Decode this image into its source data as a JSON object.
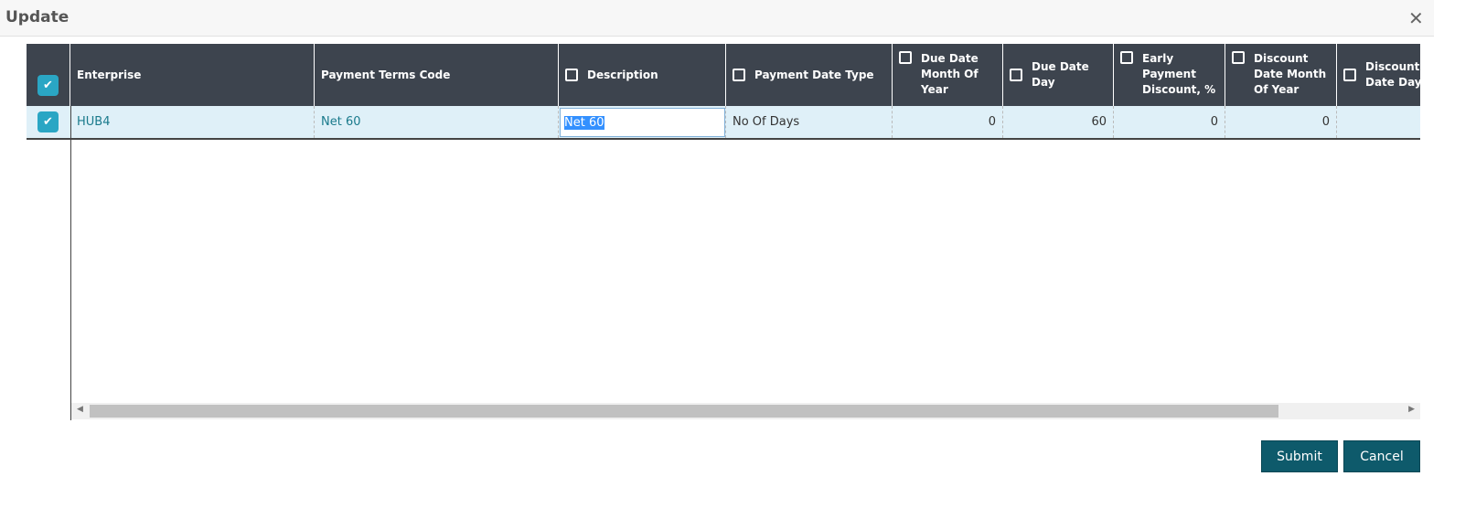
{
  "dialog": {
    "title": "Update"
  },
  "columns": [
    "Enterprise",
    "Payment Terms Code",
    "Description",
    "Payment Date Type",
    "Due Date Month Of Year",
    "Due Date Day",
    "Early Payment Discount, %",
    "Discount Date Month Of Year",
    "Discount Date Day"
  ],
  "row": {
    "enterprise": "HUB4",
    "payment_terms_code": "Net 60",
    "description": "Net 60",
    "payment_date_type": "No Of Days",
    "due_date_month_of_year": "0",
    "due_date_day": "60",
    "early_payment_discount": "0",
    "discount_date_month_of_year": "0",
    "discount_date_day": ""
  },
  "buttons": {
    "submit": "Submit",
    "cancel": "Cancel"
  },
  "icons": {
    "check": "✔",
    "close": "✕",
    "left": "◀",
    "right": "▶"
  }
}
